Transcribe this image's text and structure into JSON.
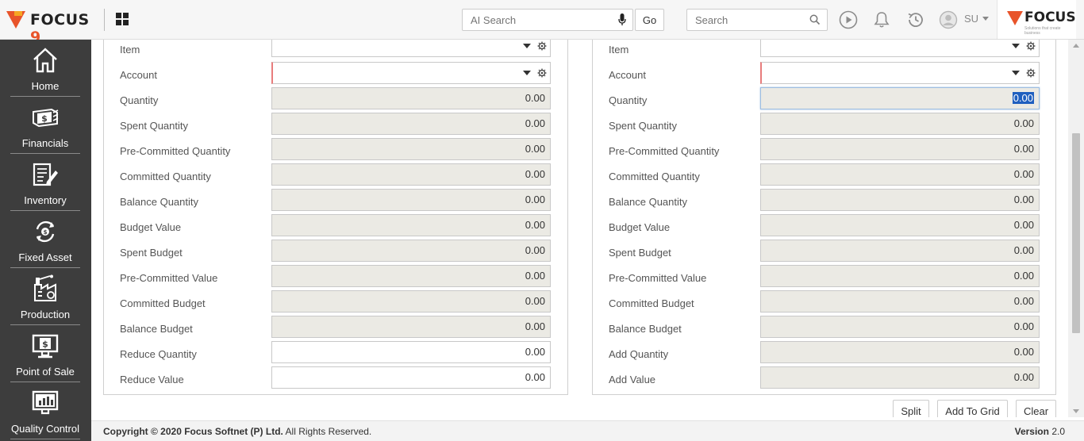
{
  "header": {
    "logo_text": "FOCUS",
    "logo_number": "9",
    "ai_search_placeholder": "AI Search",
    "go_label": "Go",
    "search_placeholder": "Search",
    "user_initials": "SU",
    "brand_text": "FOCUS",
    "brand_tagline": "Solutions that create business"
  },
  "sidebar": {
    "items": [
      {
        "label": "Home",
        "icon": "home-icon"
      },
      {
        "label": "Financials",
        "icon": "financials-icon"
      },
      {
        "label": "Inventory",
        "icon": "inventory-icon"
      },
      {
        "label": "Fixed Asset",
        "icon": "fixed-asset-icon"
      },
      {
        "label": "Production",
        "icon": "production-icon"
      },
      {
        "label": "Point of Sale",
        "icon": "point-of-sale-icon"
      },
      {
        "label": "Quality Control",
        "icon": "quality-control-icon"
      }
    ]
  },
  "left_panel": {
    "item_label": "Item",
    "account_label": "Account",
    "rows": [
      {
        "label": "Quantity",
        "value": "0.00"
      },
      {
        "label": "Spent Quantity",
        "value": "0.00"
      },
      {
        "label": "Pre-Committed Quantity",
        "value": "0.00"
      },
      {
        "label": "Committed Quantity",
        "value": "0.00"
      },
      {
        "label": "Balance Quantity",
        "value": "0.00"
      },
      {
        "label": "Budget Value",
        "value": "0.00"
      },
      {
        "label": "Spent Budget",
        "value": "0.00"
      },
      {
        "label": "Pre-Committed Value",
        "value": "0.00"
      },
      {
        "label": "Committed Budget",
        "value": "0.00"
      },
      {
        "label": "Balance Budget",
        "value": "0.00"
      },
      {
        "label": "Reduce Quantity",
        "value": "0.00"
      },
      {
        "label": "Reduce Value",
        "value": "0.00"
      }
    ]
  },
  "right_panel": {
    "item_label": "Item",
    "account_label": "Account",
    "rows": [
      {
        "label": "Quantity",
        "value": "0.00"
      },
      {
        "label": "Spent Quantity",
        "value": "0.00"
      },
      {
        "label": "Pre-Committed Quantity",
        "value": "0.00"
      },
      {
        "label": "Committed Quantity",
        "value": "0.00"
      },
      {
        "label": "Balance Quantity",
        "value": "0.00"
      },
      {
        "label": "Budget Value",
        "value": "0.00"
      },
      {
        "label": "Spent Budget",
        "value": "0.00"
      },
      {
        "label": "Pre-Committed Value",
        "value": "0.00"
      },
      {
        "label": "Committed Budget",
        "value": "0.00"
      },
      {
        "label": "Balance Budget",
        "value": "0.00"
      },
      {
        "label": "Add Quantity",
        "value": "0.00"
      },
      {
        "label": "Add Value",
        "value": "0.00"
      }
    ]
  },
  "actions": {
    "split_label": "Split",
    "add_to_grid_label": "Add To Grid",
    "clear_label": "Clear"
  },
  "footer": {
    "copyright_prefix": "Copyright © 2020",
    "company": "Focus Softnet (P) Ltd.",
    "rights": "All Rights Reserved.",
    "version_label": "Version",
    "version_number": "2.0"
  },
  "colors": {
    "sidebar_bg": "#3d3d3d",
    "brand_orange": "#e8542a",
    "readonly_field": "#ebeae4",
    "required_marker": "#e87c7c",
    "selection": "#1f5fbf"
  }
}
